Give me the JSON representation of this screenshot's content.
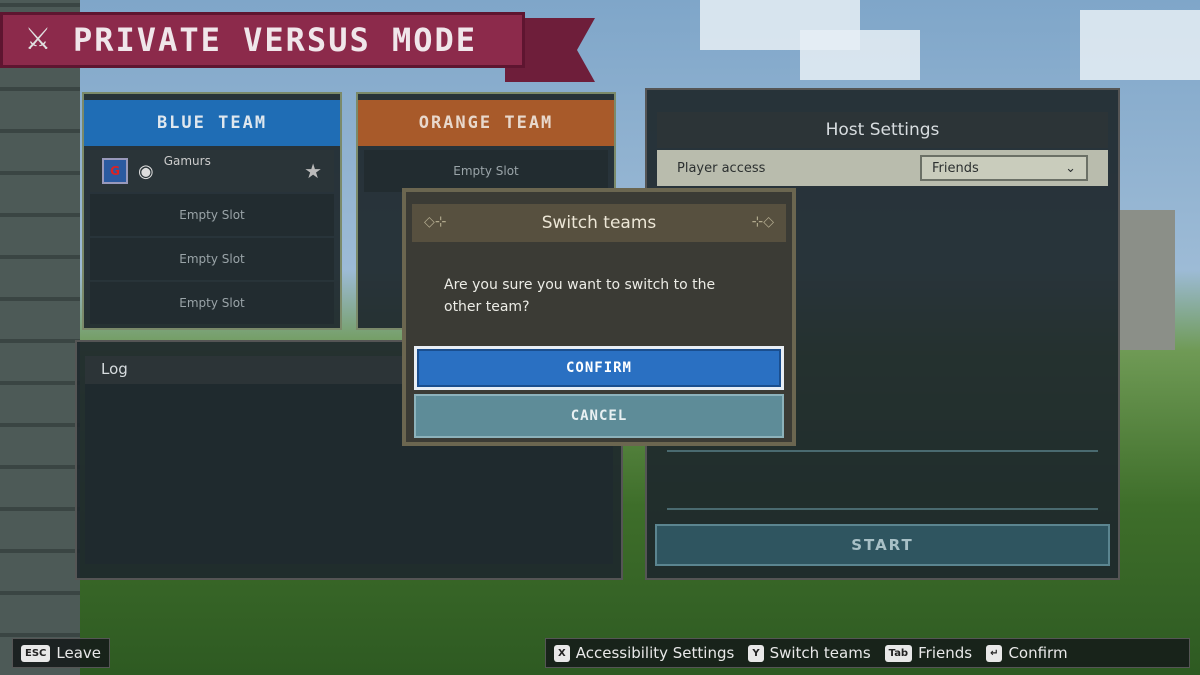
{
  "title": "PRIVATE VERSUS MODE",
  "blue_team": {
    "label": "BLUE TEAM",
    "color": "#1f6db5",
    "player": "Gamurs",
    "slots": [
      "Empty Slot",
      "Empty Slot",
      "Empty Slot"
    ]
  },
  "orange_team": {
    "label": "ORANGE TEAM",
    "color": "#a85a2a",
    "slots": [
      "Empty Slot"
    ]
  },
  "log": {
    "label": "Log"
  },
  "host_settings": {
    "title": "Host Settings",
    "player_access_label": "Player access",
    "player_access_value": "Friends",
    "start_label": "START"
  },
  "dialog": {
    "title": "Switch teams",
    "message": "Are you sure you want to switch to the other team?",
    "confirm": "CONFIRM",
    "cancel": "CANCEL"
  },
  "footer": {
    "leave_key": "ESC",
    "leave": "Leave",
    "actions": [
      {
        "key": "X",
        "label": "Accessibility Settings"
      },
      {
        "key": "Y",
        "label": "Switch teams"
      },
      {
        "key": "Tab",
        "label": "Friends"
      },
      {
        "key": "↵",
        "label": "Confirm"
      }
    ]
  }
}
